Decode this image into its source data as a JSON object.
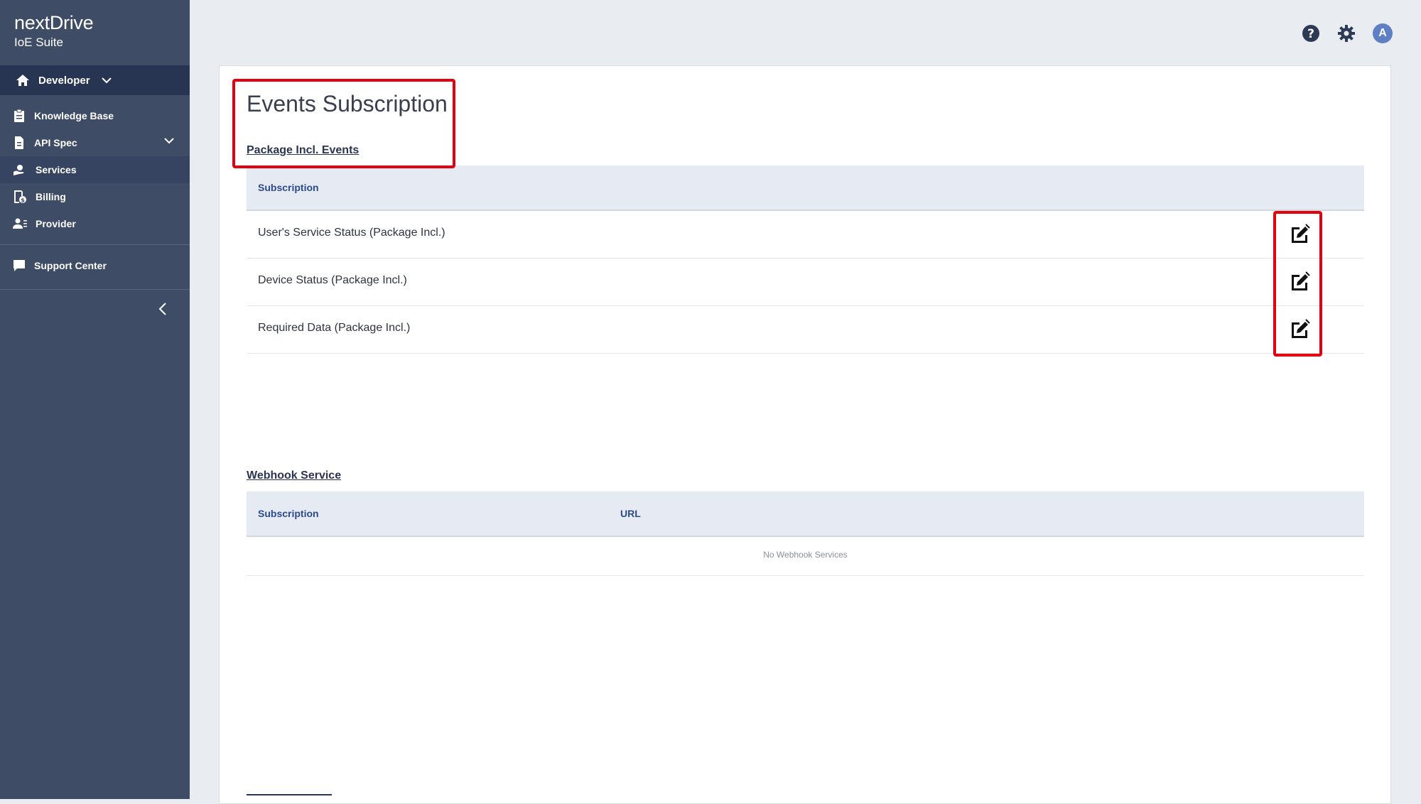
{
  "sidebar": {
    "brand": "nextDrive",
    "brand_sub": "IoE Suite",
    "section": "Developer",
    "items": [
      {
        "label": "Knowledge Base",
        "icon": "clipboard-icon"
      },
      {
        "label": "API Spec",
        "icon": "document-icon"
      },
      {
        "label": "Services",
        "icon": "services-icon"
      },
      {
        "label": "Billing",
        "icon": "billing-icon"
      },
      {
        "label": "Provider",
        "icon": "provider-icon"
      }
    ],
    "support": "Support Center"
  },
  "main": {
    "title": "Events Subscription",
    "package_section": {
      "heading": "Package Incl. Events",
      "column": "Subscription",
      "rows": [
        "User's Service Status (Package Incl.)",
        "Device Status (Package Incl.)",
        "Required Data (Package Incl.)"
      ]
    },
    "webhook_section": {
      "heading": "Webhook Service",
      "columns": [
        "Subscription",
        "URL"
      ],
      "empty_text": "No Webhook Services"
    }
  },
  "header": {
    "avatar_initial": "A"
  },
  "colors": {
    "sidebar": "#3f4c66",
    "sidebar_dark": "#273553",
    "highlight": "#e3000f",
    "table_header": "#e6ebf3"
  }
}
